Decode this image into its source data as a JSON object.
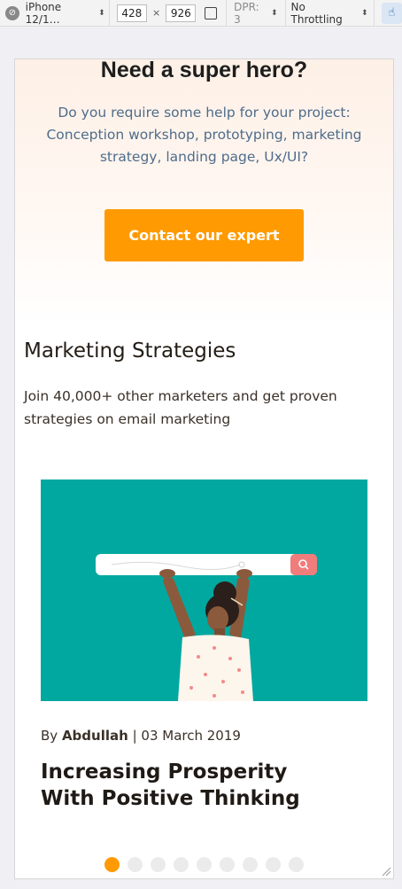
{
  "toolbar": {
    "device": "iPhone 12/1…",
    "width": "428",
    "height": "926",
    "dpr": "DPR: 3",
    "throttling": "No Throttling"
  },
  "hero": {
    "title": "Need a super hero?",
    "subtitle": "Do you require some help for your project: Conception workshop, prototyping, marketing strategy, landing page, Ux/UI?",
    "cta_label": "Contact our expert"
  },
  "section": {
    "title": "Marketing Strategies",
    "description": "Join 40,000+ other marketers and get proven strategies on email marketing"
  },
  "post": {
    "by_label": "By",
    "author": "Abdullah",
    "date": "03 March 2019",
    "title": "Increasing Prosperity With Positive Thinking"
  },
  "carousel": {
    "count": 9,
    "active_index": 0
  },
  "colors": {
    "accent": "#ff9a03",
    "image_bg": "#00a8a0",
    "subtitle": "#4f6c8b"
  }
}
